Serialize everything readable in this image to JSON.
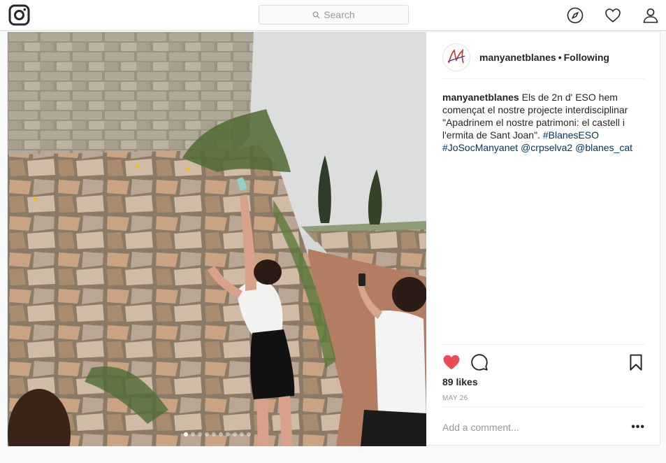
{
  "search": {
    "placeholder": "Search"
  },
  "post": {
    "username": "manyanetblanes",
    "separator": "•",
    "follow_status": "Following",
    "caption": {
      "username": "manyanetblanes",
      "text": "Els de 2n d' ESO hem començat el nostre projecte interdisciplinar \"Apadrinem el nostre patrimoni: el castell i l'ermita de Sant Joan\".",
      "hashtag1": "#BlanesESO",
      "hashtag2": "#JoSocManyanet",
      "mention1": "@crpselva2",
      "mention2": "@blanes_cat"
    },
    "likes": "89 likes",
    "date": "MAY 26",
    "comment_placeholder": "Add a comment...",
    "more_label": "•••",
    "carousel": {
      "total": 10,
      "active_index": 0
    }
  },
  "colors": {
    "like_red": "#ed4956",
    "link_blue": "#003569",
    "muted": "#999999"
  },
  "icons": {
    "logo": "instagram-logo-icon",
    "search": "search-icon",
    "explore": "compass-icon",
    "activity": "heart-icon",
    "profile": "person-icon",
    "like": "heart-filled-icon",
    "comment": "comment-icon",
    "save": "bookmark-icon"
  }
}
